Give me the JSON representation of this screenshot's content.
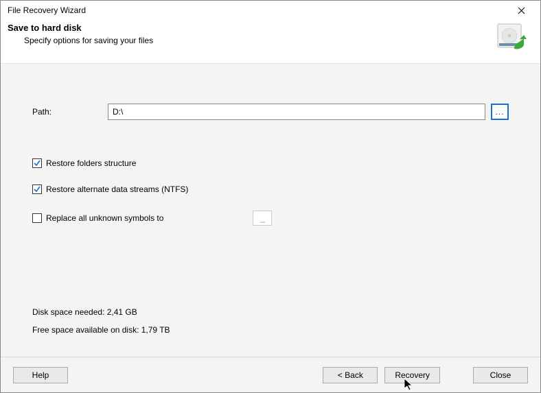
{
  "window": {
    "title": "File Recovery Wizard"
  },
  "header": {
    "title": "Save to hard disk",
    "subtitle": "Specify options for saving your files"
  },
  "path": {
    "label": "Path:",
    "value": "D:\\",
    "browse_label": "..."
  },
  "options": {
    "restore_folders": {
      "label": "Restore folders structure",
      "checked": true
    },
    "restore_ads": {
      "label": "Restore alternate data streams (NTFS)",
      "checked": true
    },
    "replace_symbols": {
      "label": "Replace all unknown symbols to",
      "checked": false,
      "value": "_"
    }
  },
  "info": {
    "space_needed": "Disk space needed: 2,41 GB",
    "space_free": "Free space available on disk: 1,79 TB"
  },
  "buttons": {
    "help": "Help",
    "back": "< Back",
    "recovery": "Recovery",
    "close": "Close"
  }
}
